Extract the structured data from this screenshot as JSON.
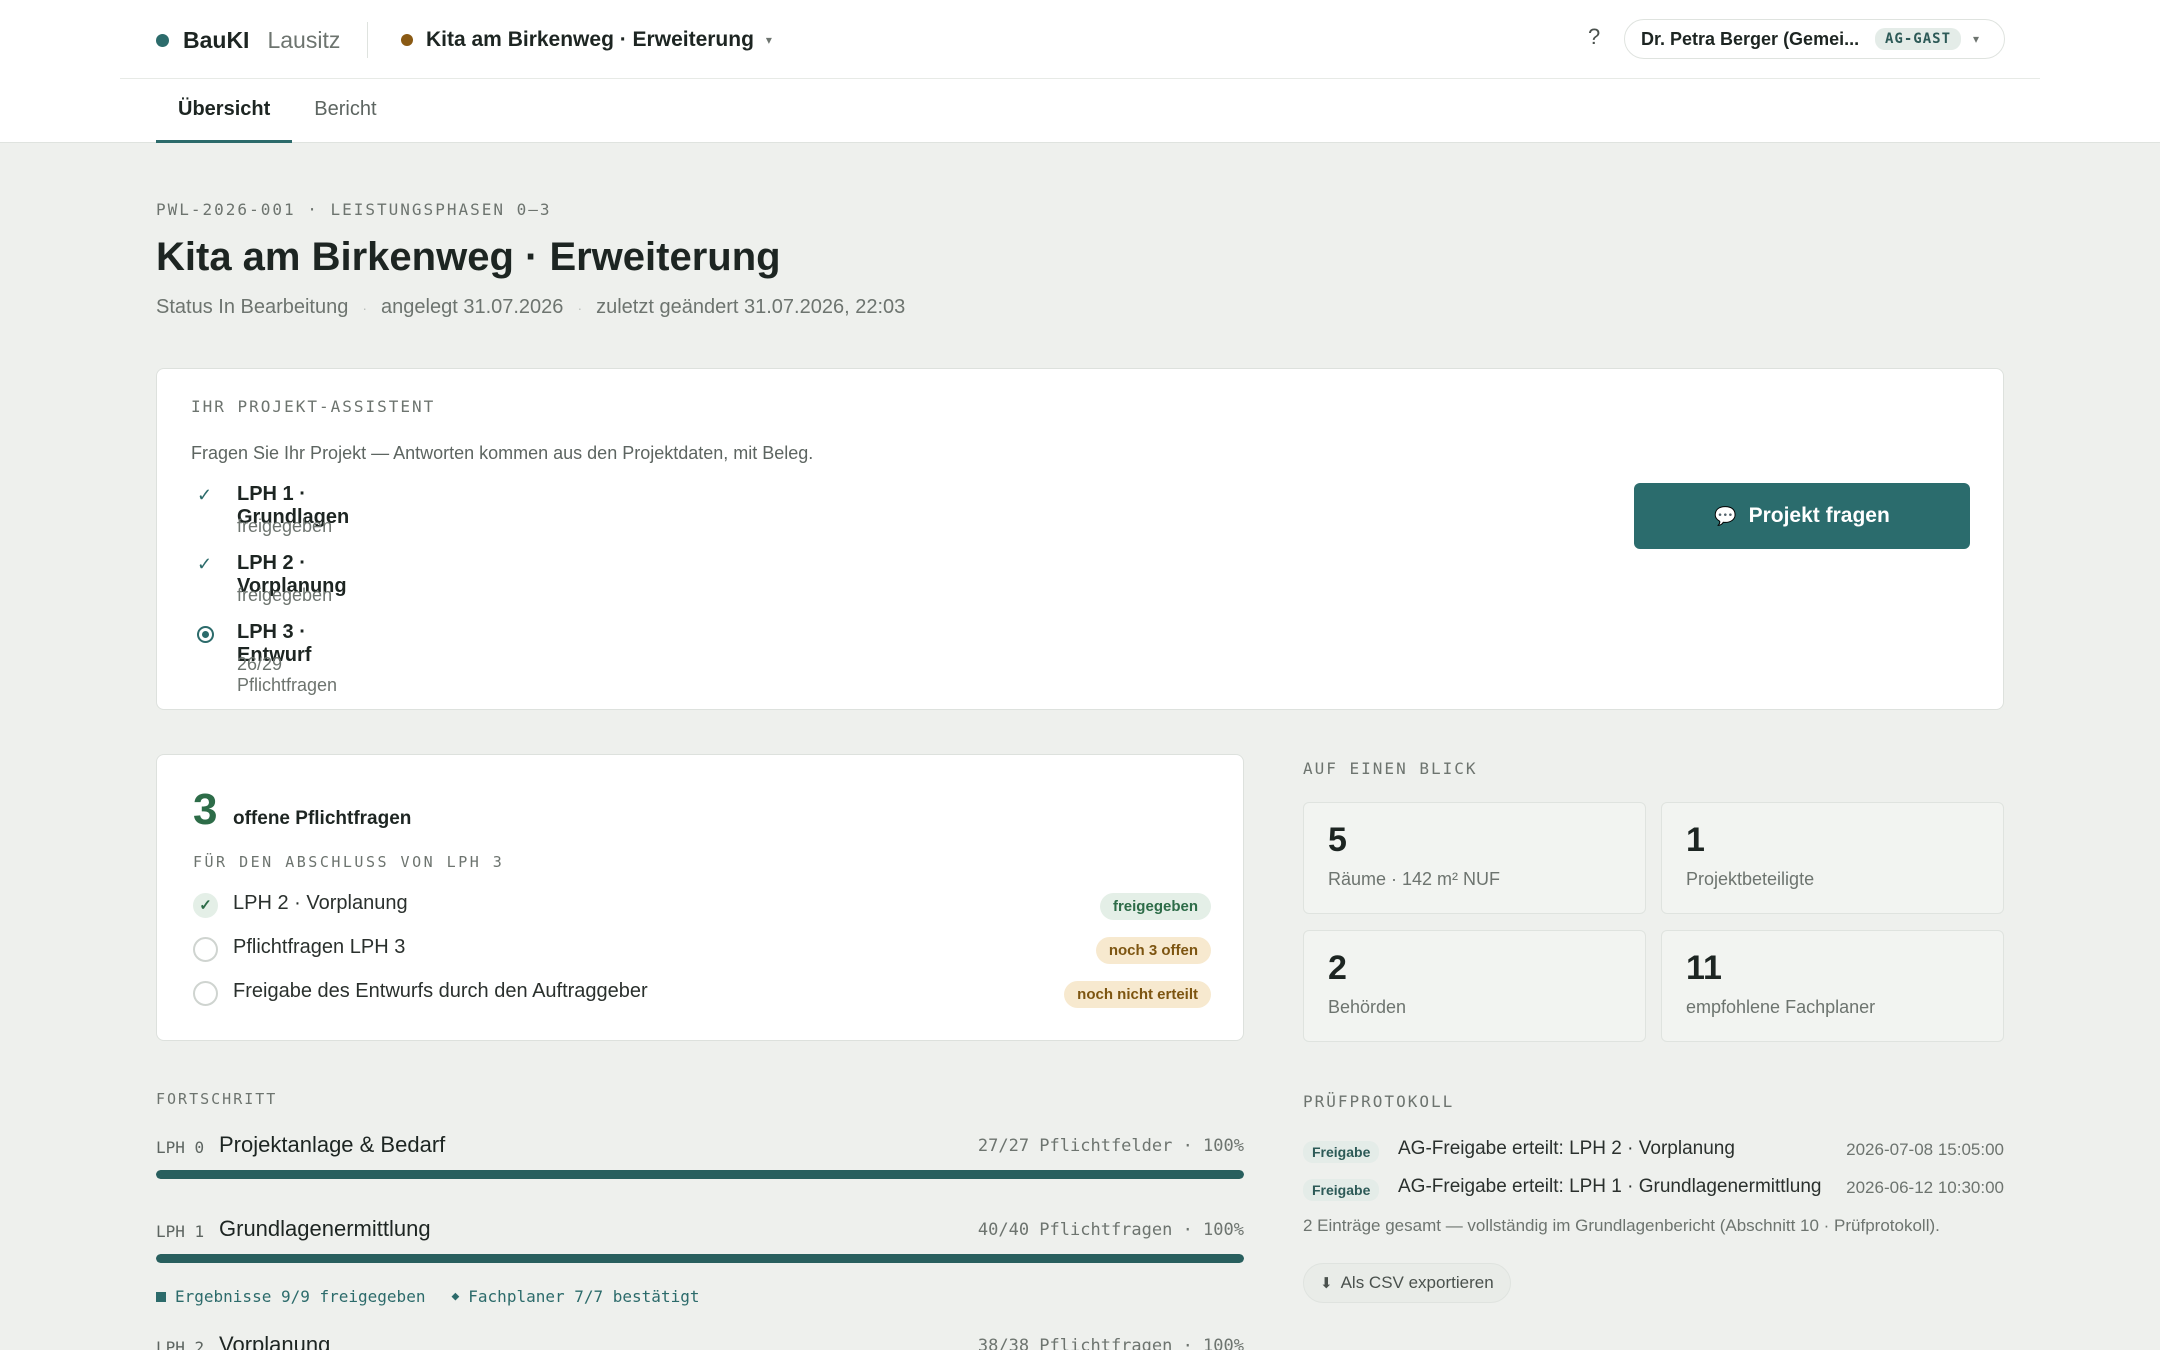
{
  "header": {
    "brand_name": "BauKI",
    "brand_region": "Lausitz",
    "brand_dot_color": "#2c6b6b",
    "project_name": "Kita am Birkenweg · Erweiterung",
    "project_dot_color": "#8a5a14",
    "project_caret": "▾",
    "help_label": "?",
    "user_name": "Dr. Petra Berger (Gemei...",
    "user_role": "AG-GAST",
    "user_caret": "▾"
  },
  "tabs": [
    {
      "label": "Übersicht",
      "active": true
    },
    {
      "label": "Bericht",
      "active": false
    }
  ],
  "page": {
    "eyebrow": "PWL-2026-001 · LEISTUNGSPHASEN 0–3",
    "title": "Kita am Birkenweg · Erweiterung",
    "status": "Status In Bearbeitung",
    "created": "angelegt 31.07.2026",
    "modified": "zuletzt geändert 31.07.2026, 22:03",
    "meta_sep": "·"
  },
  "assistant": {
    "eyebrow": "IHR PROJEKT-ASSISTENT",
    "description": "Fragen Sie Ihr Projekt — Antworten kommen aus den Projektdaten, mit Beleg.",
    "phases": [
      {
        "title": "LPH 1 · Grundlagen",
        "sub": "freigegeben",
        "icon": "check-icon",
        "glyph": "✓"
      },
      {
        "title": "LPH 2 · Vorplanung",
        "sub": "freigegeben",
        "icon": "check-icon",
        "glyph": "✓"
      },
      {
        "title": "LPH 3 · Entwurf",
        "sub": "26/29 Pflichtfragen",
        "icon": "radio-active-icon",
        "glyph": ""
      }
    ],
    "button_label": "Projekt fragen",
    "button_icon": "chat-bubble-icon",
    "button_glyph": "💬",
    "button_color": "#2b6c6d"
  },
  "open_questions": {
    "count": "3",
    "label": "offene Pflichtfragen",
    "eyebrow": "FÜR DEN ABSCHLUSS VON LPH 3",
    "items": [
      {
        "text": "LPH 2 · Vorplanung",
        "done": true,
        "glyph": "✓",
        "pill": "freigegeben",
        "pill_type": "green"
      },
      {
        "text": "Pflichtfragen LPH 3",
        "done": false,
        "glyph": "",
        "pill": "noch 3 offen",
        "pill_type": "amber"
      },
      {
        "text": "Freigabe des Entwurfs durch den Auftraggeber",
        "done": false,
        "glyph": "",
        "pill": "noch nicht erteilt",
        "pill_type": "amber"
      }
    ]
  },
  "progress": {
    "eyebrow": "FORTSCHRITT",
    "phases": [
      {
        "code": "LPH 0",
        "name": "Projektanlage & Bedarf",
        "stat": "27/27 Pflichtfelder · 100%",
        "percent": 100
      },
      {
        "code": "LPH 1",
        "name": "Grundlagenermittlung",
        "stat": "40/40 Pflichtfragen · 100%",
        "percent": 100
      },
      {
        "code": "LPH 2",
        "name": "Vorplanung",
        "stat": "38/38 Pflichtfragen · 100%",
        "percent": 100
      }
    ],
    "substat_results": "Ergebnisse 9/9 freigegeben",
    "substat_planners": "Fachplaner 7/7 bestätigt",
    "diamond_glyph": "◆",
    "bar_color": "#285f5e"
  },
  "glance": {
    "eyebrow": "AUF EINEN BLICK",
    "stats": [
      {
        "value": "5",
        "label": "Räume · 142 m² NUF"
      },
      {
        "value": "1",
        "label": "Projektbeteiligte"
      },
      {
        "value": "2",
        "label": "Behörden"
      },
      {
        "value": "11",
        "label": "empfohlene Fachplaner"
      }
    ]
  },
  "audit": {
    "eyebrow": "PRÜFPROTOKOLL",
    "entries": [
      {
        "badge": "Freigabe",
        "text": "AG-Freigabe erteilt: LPH 2 · Vorplanung",
        "time": "2026-07-08 15:05:00"
      },
      {
        "badge": "Freigabe",
        "text": "AG-Freigabe erteilt: LPH 1 · Grundlagenermittlung",
        "time": "2026-06-12 10:30:00"
      }
    ],
    "summary": "2 Einträge gesamt — vollständig im Grundlagenbericht (Abschnitt 10 · Prüfprotokoll).",
    "csv_label": "Als CSV exportieren",
    "csv_icon": "download-icon",
    "csv_glyph": "⬇"
  }
}
